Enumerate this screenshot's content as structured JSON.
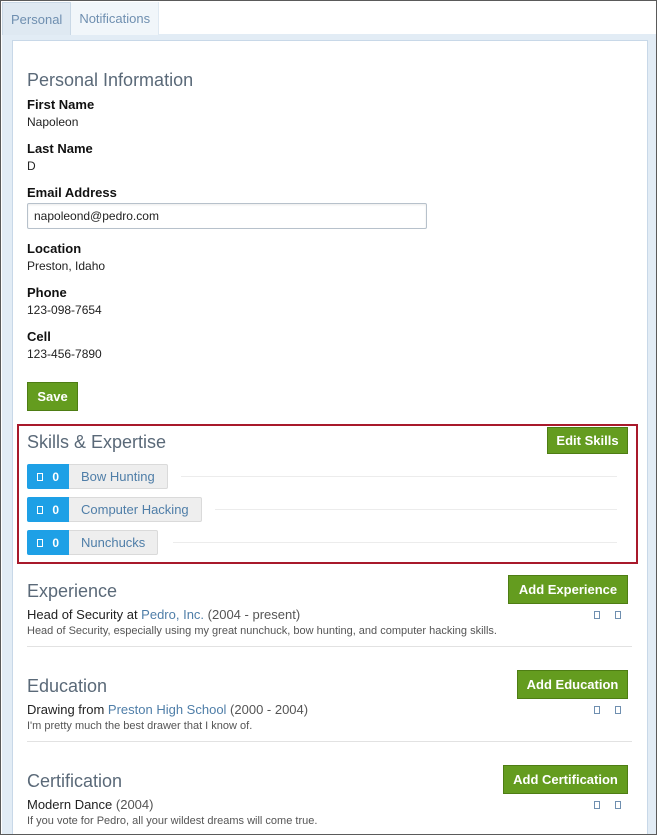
{
  "tabs": [
    {
      "label": "Personal"
    },
    {
      "label": "Notifications"
    }
  ],
  "personal": {
    "heading": "Personal Information",
    "first_name_label": "First Name",
    "first_name": "Napoleon",
    "last_name_label": "Last Name",
    "last_name": "D",
    "email_label": "Email Address",
    "email": "napoleond@pedro.com",
    "location_label": "Location",
    "location": "Preston, Idaho",
    "phone_label": "Phone",
    "phone": "123-098-7654",
    "cell_label": "Cell",
    "cell": "123-456-7890",
    "save_label": "Save"
  },
  "skills": {
    "heading": "Skills & Expertise",
    "edit_label": "Edit Skills",
    "items": [
      {
        "count": "0",
        "name": "Bow Hunting"
      },
      {
        "count": "0",
        "name": "Computer Hacking"
      },
      {
        "count": "0",
        "name": "Nunchucks"
      }
    ]
  },
  "experience": {
    "heading": "Experience",
    "add_label": "Add Experience",
    "entry": {
      "prefix": "Head of Security at ",
      "link": "Pedro, Inc.",
      "dates": " (2004 - present)",
      "description": "Head of Security, especially using my great nunchuck, bow hunting, and computer hacking skills."
    }
  },
  "education": {
    "heading": "Education",
    "add_label": "Add Education",
    "entry": {
      "prefix": "Drawing from ",
      "link": "Preston High School",
      "dates": " (2000 - 2004)",
      "description": "I'm pretty much the best drawer that I know of."
    }
  },
  "certification": {
    "heading": "Certification",
    "add_label": "Add Certification",
    "entry": {
      "prefix": "Modern Dance",
      "dates": " (2004)",
      "description": "If you vote for Pedro, all your wildest dreams will come true."
    }
  },
  "colors": {
    "accent_green": "#649c1f",
    "skill_blue": "#1ea0e6",
    "highlight_red": "#a8192b",
    "link_blue": "#4f7ea8"
  }
}
